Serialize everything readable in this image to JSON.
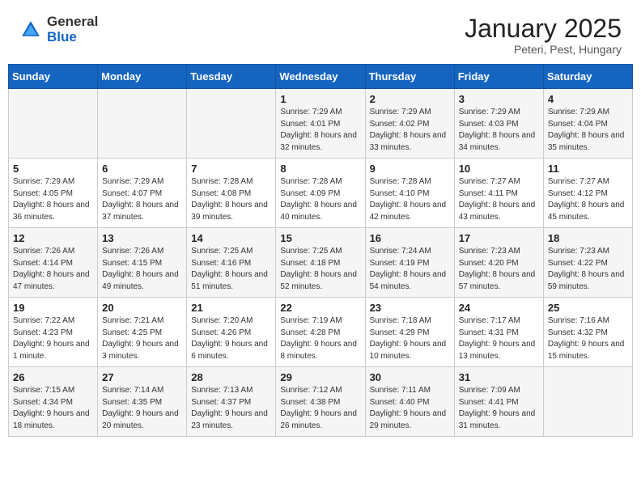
{
  "header": {
    "logo_general": "General",
    "logo_blue": "Blue",
    "month_title": "January 2025",
    "subtitle": "Peteri, Pest, Hungary"
  },
  "weekdays": [
    "Sunday",
    "Monday",
    "Tuesday",
    "Wednesday",
    "Thursday",
    "Friday",
    "Saturday"
  ],
  "weeks": [
    [
      {
        "day": "",
        "info": ""
      },
      {
        "day": "",
        "info": ""
      },
      {
        "day": "",
        "info": ""
      },
      {
        "day": "1",
        "info": "Sunrise: 7:29 AM\nSunset: 4:01 PM\nDaylight: 8 hours and 32 minutes."
      },
      {
        "day": "2",
        "info": "Sunrise: 7:29 AM\nSunset: 4:02 PM\nDaylight: 8 hours and 33 minutes."
      },
      {
        "day": "3",
        "info": "Sunrise: 7:29 AM\nSunset: 4:03 PM\nDaylight: 8 hours and 34 minutes."
      },
      {
        "day": "4",
        "info": "Sunrise: 7:29 AM\nSunset: 4:04 PM\nDaylight: 8 hours and 35 minutes."
      }
    ],
    [
      {
        "day": "5",
        "info": "Sunrise: 7:29 AM\nSunset: 4:05 PM\nDaylight: 8 hours and 36 minutes."
      },
      {
        "day": "6",
        "info": "Sunrise: 7:29 AM\nSunset: 4:07 PM\nDaylight: 8 hours and 37 minutes."
      },
      {
        "day": "7",
        "info": "Sunrise: 7:28 AM\nSunset: 4:08 PM\nDaylight: 8 hours and 39 minutes."
      },
      {
        "day": "8",
        "info": "Sunrise: 7:28 AM\nSunset: 4:09 PM\nDaylight: 8 hours and 40 minutes."
      },
      {
        "day": "9",
        "info": "Sunrise: 7:28 AM\nSunset: 4:10 PM\nDaylight: 8 hours and 42 minutes."
      },
      {
        "day": "10",
        "info": "Sunrise: 7:27 AM\nSunset: 4:11 PM\nDaylight: 8 hours and 43 minutes."
      },
      {
        "day": "11",
        "info": "Sunrise: 7:27 AM\nSunset: 4:12 PM\nDaylight: 8 hours and 45 minutes."
      }
    ],
    [
      {
        "day": "12",
        "info": "Sunrise: 7:26 AM\nSunset: 4:14 PM\nDaylight: 8 hours and 47 minutes."
      },
      {
        "day": "13",
        "info": "Sunrise: 7:26 AM\nSunset: 4:15 PM\nDaylight: 8 hours and 49 minutes."
      },
      {
        "day": "14",
        "info": "Sunrise: 7:25 AM\nSunset: 4:16 PM\nDaylight: 8 hours and 51 minutes."
      },
      {
        "day": "15",
        "info": "Sunrise: 7:25 AM\nSunset: 4:18 PM\nDaylight: 8 hours and 52 minutes."
      },
      {
        "day": "16",
        "info": "Sunrise: 7:24 AM\nSunset: 4:19 PM\nDaylight: 8 hours and 54 minutes."
      },
      {
        "day": "17",
        "info": "Sunrise: 7:23 AM\nSunset: 4:20 PM\nDaylight: 8 hours and 57 minutes."
      },
      {
        "day": "18",
        "info": "Sunrise: 7:23 AM\nSunset: 4:22 PM\nDaylight: 8 hours and 59 minutes."
      }
    ],
    [
      {
        "day": "19",
        "info": "Sunrise: 7:22 AM\nSunset: 4:23 PM\nDaylight: 9 hours and 1 minute."
      },
      {
        "day": "20",
        "info": "Sunrise: 7:21 AM\nSunset: 4:25 PM\nDaylight: 9 hours and 3 minutes."
      },
      {
        "day": "21",
        "info": "Sunrise: 7:20 AM\nSunset: 4:26 PM\nDaylight: 9 hours and 6 minutes."
      },
      {
        "day": "22",
        "info": "Sunrise: 7:19 AM\nSunset: 4:28 PM\nDaylight: 9 hours and 8 minutes."
      },
      {
        "day": "23",
        "info": "Sunrise: 7:18 AM\nSunset: 4:29 PM\nDaylight: 9 hours and 10 minutes."
      },
      {
        "day": "24",
        "info": "Sunrise: 7:17 AM\nSunset: 4:31 PM\nDaylight: 9 hours and 13 minutes."
      },
      {
        "day": "25",
        "info": "Sunrise: 7:16 AM\nSunset: 4:32 PM\nDaylight: 9 hours and 15 minutes."
      }
    ],
    [
      {
        "day": "26",
        "info": "Sunrise: 7:15 AM\nSunset: 4:34 PM\nDaylight: 9 hours and 18 minutes."
      },
      {
        "day": "27",
        "info": "Sunrise: 7:14 AM\nSunset: 4:35 PM\nDaylight: 9 hours and 20 minutes."
      },
      {
        "day": "28",
        "info": "Sunrise: 7:13 AM\nSunset: 4:37 PM\nDaylight: 9 hours and 23 minutes."
      },
      {
        "day": "29",
        "info": "Sunrise: 7:12 AM\nSunset: 4:38 PM\nDaylight: 9 hours and 26 minutes."
      },
      {
        "day": "30",
        "info": "Sunrise: 7:11 AM\nSunset: 4:40 PM\nDaylight: 9 hours and 29 minutes."
      },
      {
        "day": "31",
        "info": "Sunrise: 7:09 AM\nSunset: 4:41 PM\nDaylight: 9 hours and 31 minutes."
      },
      {
        "day": "",
        "info": ""
      }
    ]
  ]
}
